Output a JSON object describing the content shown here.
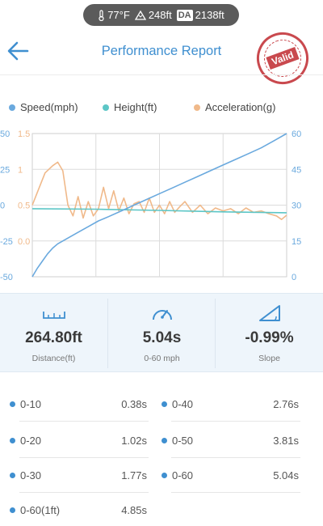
{
  "status": {
    "temperature": "77°F",
    "elevation": "248ft",
    "density_altitude_label": "DA",
    "density_altitude": "2138ft"
  },
  "header": {
    "title": "Performance Report",
    "stamp_text": "Valid"
  },
  "legend": [
    {
      "label": "Speed(mph)",
      "color": "#6aa9de"
    },
    {
      "label": "Height(ft)",
      "color": "#5cc6c6"
    },
    {
      "label": "Acceleration(g)",
      "color": "#f0b98a"
    }
  ],
  "chart_data": {
    "type": "line",
    "left_axis_speed_ticks": [
      "50",
      "25",
      "0",
      "-25",
      "-50"
    ],
    "left_axis_accel_ticks": [
      "1.5",
      "1",
      "0.5",
      "0.0",
      ""
    ],
    "right_axis_height_ticks": [
      "60",
      "45",
      "30",
      "15",
      "0"
    ],
    "grid": true,
    "series": [
      {
        "name": "Speed(mph)",
        "x": [
          0,
          2,
          4,
          6,
          8,
          10,
          14,
          18,
          22,
          26,
          30,
          35,
          40,
          45,
          50,
          55,
          60,
          65,
          70,
          75,
          80,
          85,
          90,
          95,
          100
        ],
        "y": [
          -50,
          -44,
          -39,
          -34,
          -30,
          -27,
          -23,
          -19,
          -15,
          -11,
          -8,
          -4,
          0,
          4,
          8,
          12,
          16,
          20,
          24,
          28,
          32,
          36,
          40,
          45,
          50
        ]
      },
      {
        "name": "Height(ft)",
        "x": [
          0,
          25,
          50,
          75,
          100
        ],
        "y": [
          28.5,
          28.3,
          27.8,
          27.2,
          26.8
        ]
      },
      {
        "name": "Acceleration(g)",
        "x": [
          0,
          2,
          5,
          8,
          10,
          12,
          14,
          16,
          18,
          20,
          22,
          24,
          26,
          28,
          30,
          32,
          34,
          36,
          38,
          40,
          42,
          44,
          46,
          48,
          50,
          52,
          54,
          56,
          58,
          60,
          63,
          66,
          69,
          72,
          75,
          78,
          81,
          84,
          87,
          90,
          93,
          96,
          98,
          100
        ],
        "y": [
          0.5,
          0.68,
          0.95,
          1.05,
          1.1,
          0.98,
          0.5,
          0.35,
          0.62,
          0.32,
          0.55,
          0.35,
          0.45,
          0.75,
          0.45,
          0.7,
          0.42,
          0.6,
          0.38,
          0.52,
          0.55,
          0.4,
          0.6,
          0.4,
          0.5,
          0.38,
          0.55,
          0.4,
          0.48,
          0.55,
          0.4,
          0.5,
          0.38,
          0.46,
          0.42,
          0.45,
          0.38,
          0.46,
          0.4,
          0.42,
          0.38,
          0.35,
          0.3,
          0.36
        ]
      }
    ]
  },
  "stats": [
    {
      "value": "264.80ft",
      "label": "Distance(ft)",
      "icon": "ruler-icon"
    },
    {
      "value": "5.04s",
      "label": "0-60 mph",
      "icon": "speedometer-icon"
    },
    {
      "value": "-0.99%",
      "label": "Slope",
      "icon": "slope-icon"
    }
  ],
  "splits": {
    "left": [
      {
        "label": "0-10",
        "value": "0.38s"
      },
      {
        "label": "0-20",
        "value": "1.02s"
      },
      {
        "label": "0-30",
        "value": "1.77s"
      },
      {
        "label": "0-60(1ft)",
        "value": "4.85s"
      }
    ],
    "right": [
      {
        "label": "0-40",
        "value": "2.76s"
      },
      {
        "label": "0-50",
        "value": "3.81s"
      },
      {
        "label": "0-60",
        "value": "5.04s"
      }
    ]
  },
  "colors": {
    "accent": "#3f8fd0",
    "speed": "#6aa9de",
    "height": "#5cc6c6",
    "acceleration": "#f0b98a",
    "stamp": "#c9494e"
  }
}
